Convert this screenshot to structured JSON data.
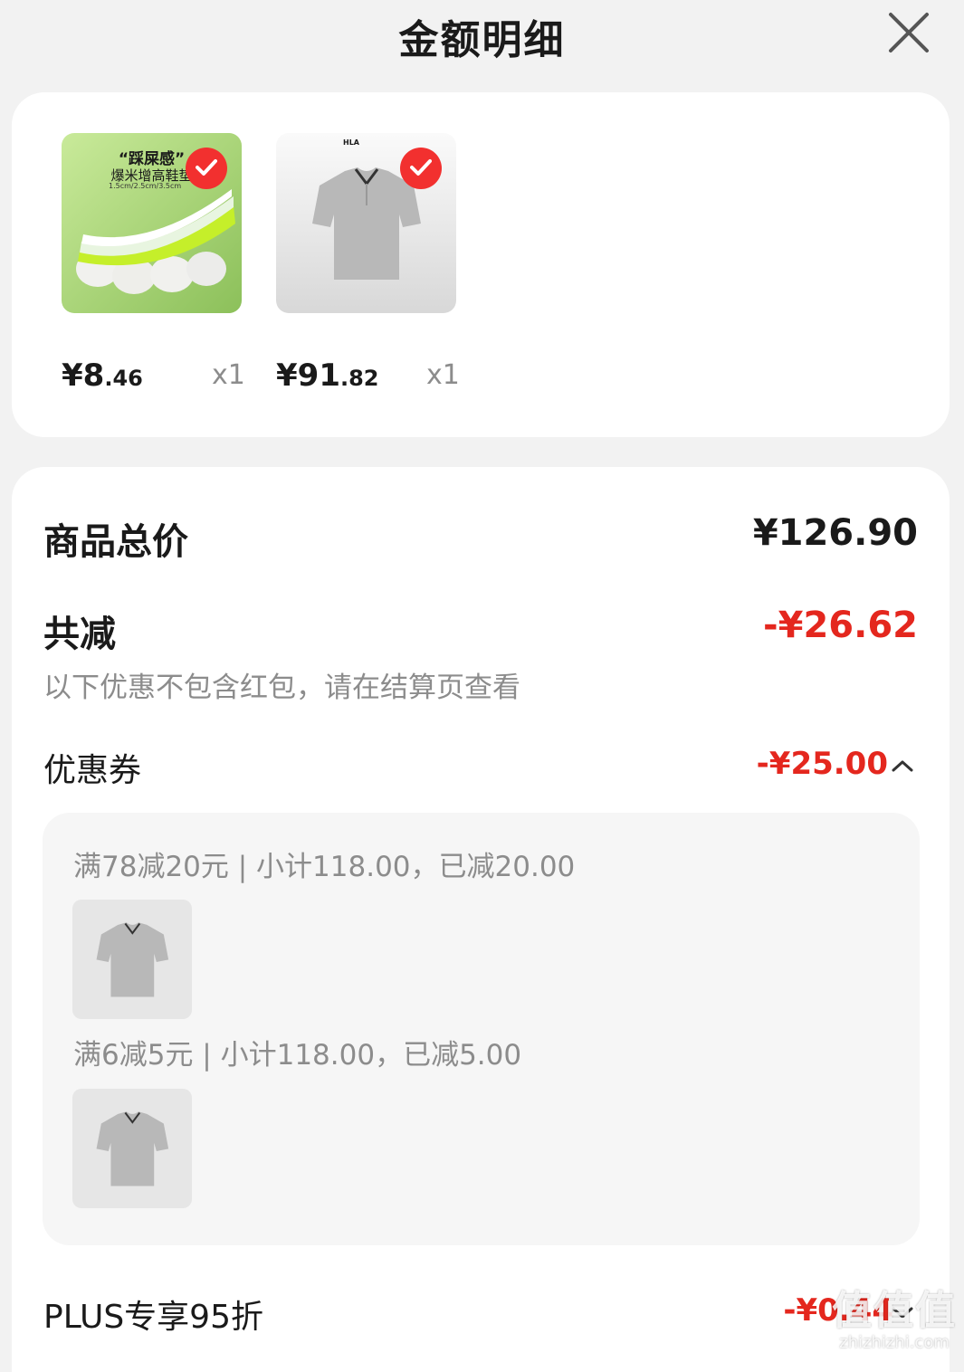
{
  "header": {
    "title": "金额明细"
  },
  "products": [
    {
      "caption_title": "“踩屎感”",
      "caption_sub": "爆米增高鞋垫",
      "caption_sizes": "1.5cm/2.5cm/3.5cm",
      "price_int": "¥8",
      "price_dec": ".46",
      "qty": "x1"
    },
    {
      "brand": "HLA",
      "price_int": "¥91",
      "price_dec": ".82",
      "qty": "x1"
    }
  ],
  "summary": {
    "total_label": "商品总价",
    "total_value": "¥126.90",
    "discount_label": "共减",
    "discount_value": "-¥26.62",
    "discount_note": "以下优惠不包含红包，请在结算页查看"
  },
  "coupon": {
    "label": "优惠券",
    "value": "-¥25.00",
    "rules": [
      {
        "text": "满78减20元 | 小计118.00，已减20.00"
      },
      {
        "text": "满6减5元 | 小计118.00，已减5.00"
      }
    ]
  },
  "plus": {
    "label": "PLUS专享95折",
    "value": "-¥0.44"
  },
  "watermark": {
    "big": "值值值",
    "small": "zhizhizhi.com"
  },
  "colors": {
    "accent_red": "#e4271e",
    "check_red": "#f2302f",
    "insole_green": "#a7d65a"
  }
}
